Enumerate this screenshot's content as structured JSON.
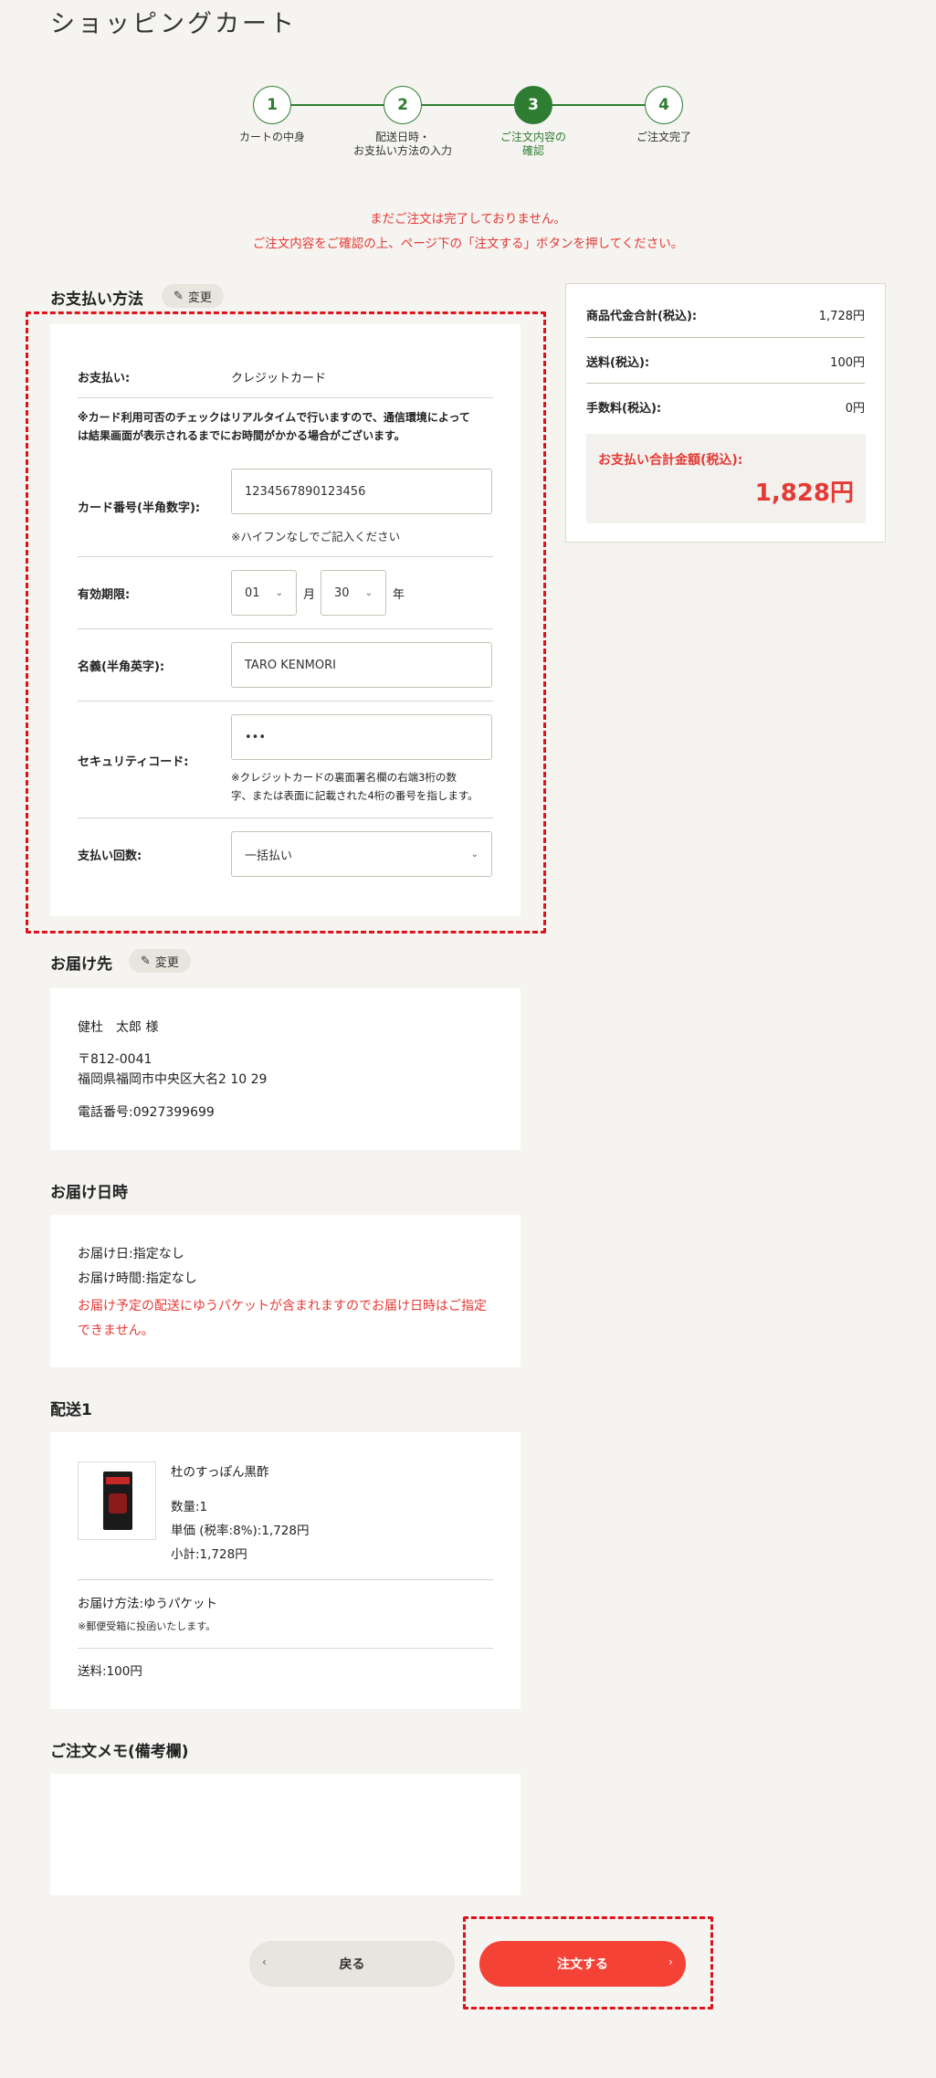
{
  "header": {
    "title": "ショッピングカート"
  },
  "stepper": {
    "steps": [
      {
        "num": "1",
        "label": "カートの中身"
      },
      {
        "num": "2",
        "label": "配送日時・\nお支払い方法の入力"
      },
      {
        "num": "3",
        "label": "ご注文内容の\n確認"
      },
      {
        "num": "4",
        "label": "ご注文完了"
      }
    ]
  },
  "warnings": {
    "line1": "まだご注文は完了しておりません。",
    "line2": "ご注文内容をご確認の上、ページ下の「注文する」ボタンを押してください。"
  },
  "payment": {
    "title": "お支払い方法",
    "change_label": "変更",
    "method_label": "お支払い:",
    "method_value": "クレジットカード",
    "realtime_note": "※カード利用可否のチェックはリアルタイムで行いますので、通信環境によって\nは結果画面が表示されるまでにお時間がかかる場合がございます。",
    "card_label": "カード番号(半角数字):",
    "card_value": "1234567890123456",
    "card_note": "※ハイフンなしでご記入ください",
    "expiry_label": "有効期限:",
    "expiry_month": "01",
    "month_unit": "月",
    "expiry_year": "30",
    "year_unit": "年",
    "name_label": "名義(半角英字):",
    "name_value": "TARO KENMORI",
    "security_label": "セキュリティコード:",
    "security_value": "•••",
    "security_note": "※クレジットカードの裏面署名欄の右端3桁の数\n字、または表面に記載された4桁の番号を指します。",
    "installments_label": "支払い回数:",
    "installments_value": "一括払い"
  },
  "summary": {
    "subtotal_label": "商品代金合計(税込):",
    "subtotal_value": "1,728円",
    "shipping_label": "送料(税込):",
    "shipping_value": "100円",
    "fee_label": "手数料(税込):",
    "fee_value": "0円",
    "total_label": "お支払い合計金額(税込):",
    "total_value": "1,828円"
  },
  "delivery_address": {
    "title": "お届け先",
    "change_label": "変更",
    "name": "健杜　太郎 様",
    "postal": "〒812-0041",
    "address": "福岡県福岡市中央区大名2 10 29",
    "phone": "電話番号:0927399699"
  },
  "delivery_date": {
    "title": "お届け日時",
    "date": "お届け日:指定なし",
    "time": "お届け時間:指定なし",
    "warning": "お届け予定の配送にゆうパケットが含まれますのでお届け日時はご指定\nできません。"
  },
  "shipment": {
    "title": "配送1",
    "product_name": "杜のすっぽん黒酢",
    "quantity": "数量:1",
    "unit_price": "単価 (税率:8%):1,728円",
    "subtotal": "小計:1,728円",
    "method": "お届け方法:ゆうパケット",
    "method_note": "※郵便受箱に投函いたします。",
    "shipping": "送料:100円"
  },
  "memo": {
    "title": "ご注文メモ(備考欄)",
    "value": ""
  },
  "actions": {
    "back_label": "戻る",
    "order_label": "注文する"
  },
  "colors": {
    "accent_green": "#2e7d32",
    "accent_red": "#f44336",
    "dashed_red": "#e0121b"
  }
}
